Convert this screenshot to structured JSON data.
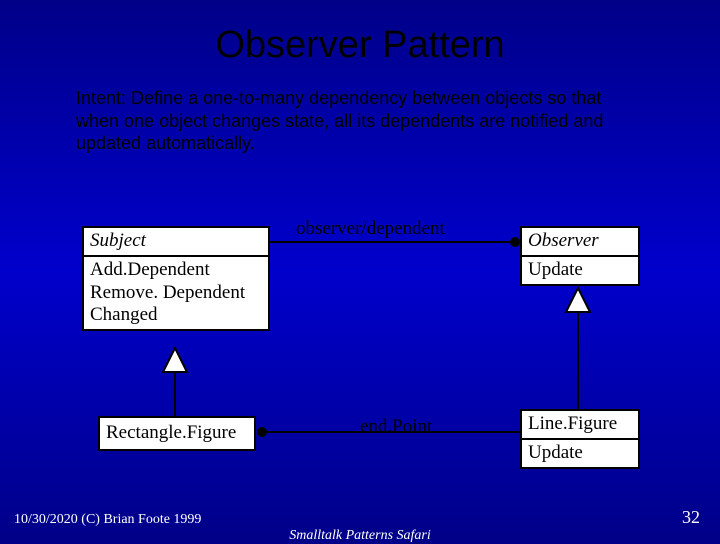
{
  "title": "Observer Pattern",
  "intent": {
    "label": "Intent:  ",
    "body": "Define a one-to-many dependency between objects so that when one object changes state, all its dependents are notified and updated automatically."
  },
  "classes": {
    "subject": {
      "name": "Subject",
      "methods": [
        "Add.Dependent",
        "Remove. Dependent",
        "Changed"
      ]
    },
    "observer": {
      "name": "Observer",
      "method": "Update"
    },
    "rectangleFigure": {
      "name": "Rectangle.Figure"
    },
    "lineFigure": {
      "name": "Line.Figure",
      "method": "Update"
    }
  },
  "relations": {
    "observerDependent": "observer/dependent",
    "endPoint": "end.Point"
  },
  "footer": {
    "date_copyright": "10/30/2020 (C) Brian Foote 1999",
    "center": "Smalltalk Patterns Safari",
    "page": "32"
  }
}
